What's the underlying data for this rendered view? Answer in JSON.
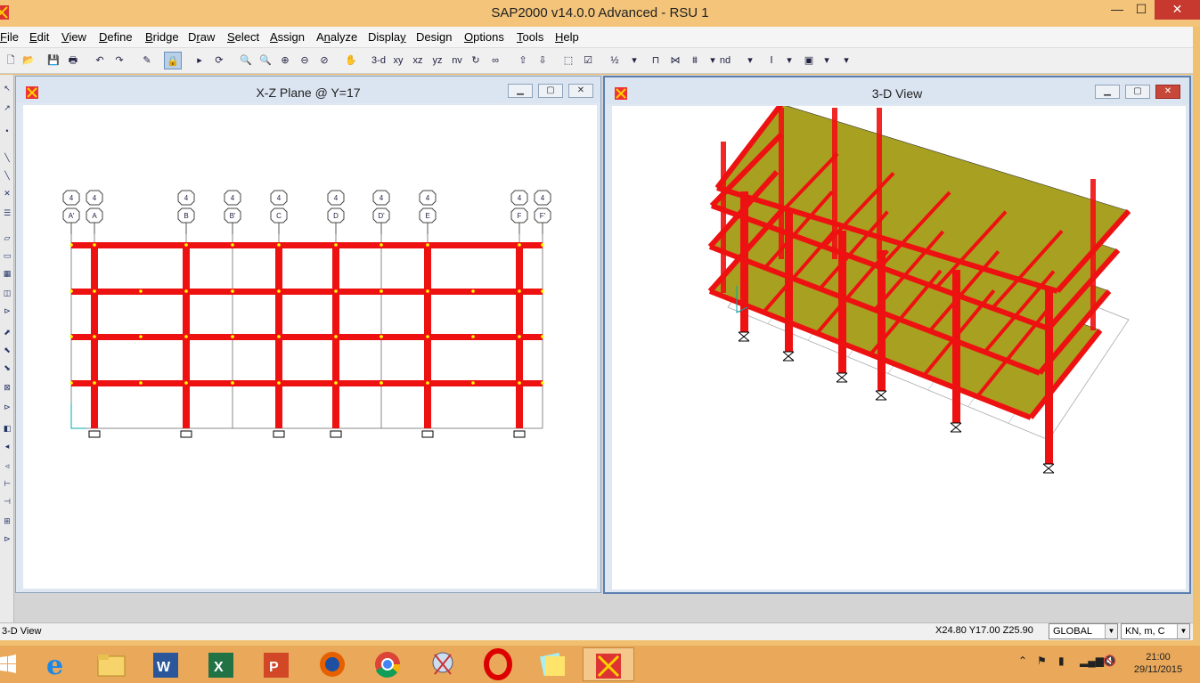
{
  "window": {
    "title": "SAP2000 v14.0.0 Advanced  - RSU 1",
    "min_glyph": "—",
    "max_glyph": "☐",
    "close_glyph": "✕"
  },
  "menu": [
    {
      "label": "File",
      "key": "F"
    },
    {
      "label": "Edit",
      "key": "E"
    },
    {
      "label": "View",
      "key": "V"
    },
    {
      "label": "Define",
      "key": "D"
    },
    {
      "label": "Bridge",
      "key": "B"
    },
    {
      "label": "Draw",
      "key": "r"
    },
    {
      "label": "Select",
      "key": "S"
    },
    {
      "label": "Assign",
      "key": "A"
    },
    {
      "label": "Analyze",
      "key": "n"
    },
    {
      "label": "Display",
      "key": "y"
    },
    {
      "label": "Design",
      "key": "g"
    },
    {
      "label": "Options",
      "key": "O"
    },
    {
      "label": "Tools",
      "key": "T"
    },
    {
      "label": "Help",
      "key": "H"
    }
  ],
  "toolbar": {
    "view_3d": "3-d",
    "view_xy": "xy",
    "view_xz": "xz",
    "view_yz": "yz",
    "view_nv": "nv",
    "nd_label": "nd"
  },
  "windows": {
    "left": {
      "title": "X-Z Plane @ Y=17",
      "grid_labels": [
        "A'",
        "A",
        "B",
        "B'",
        "C",
        "D",
        "D'",
        "E",
        "F",
        "F'"
      ],
      "grid_top_label": "4"
    },
    "right": {
      "title": "3-D View"
    }
  },
  "status": {
    "active_view": "3-D View",
    "coordinates": "X24.80  Y17.00  Z25.90",
    "coord_system": "GLOBAL",
    "units": "KN, m, C"
  },
  "taskbar": {
    "apps": [
      "Internet Explorer",
      "File Explorer",
      "Word",
      "Excel",
      "PowerPoint",
      "Firefox",
      "Chrome",
      "Snipping Tool",
      "Opera",
      "Sticky Notes",
      "SAP2000"
    ],
    "time": "21:00",
    "date": "29/11/2015"
  },
  "colors": {
    "frame": "#ee1111",
    "slab": "#a8a020",
    "title_bar": "#f3c47a",
    "taskbar": "#e9a85a"
  }
}
